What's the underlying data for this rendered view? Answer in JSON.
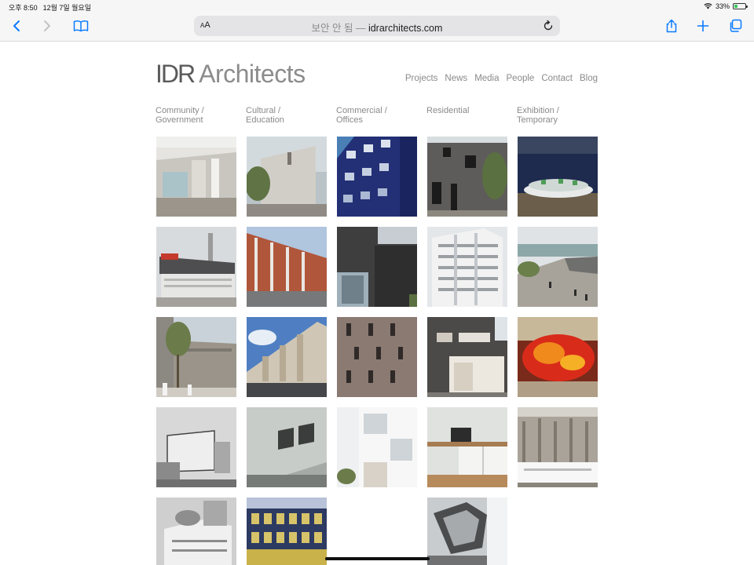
{
  "status_bar": {
    "time": "오후 8:50",
    "date": "12월 7일 월요일",
    "battery": "33%",
    "battery_level": 0.33
  },
  "toolbar": {
    "aa_label_big": "A",
    "aa_label_small": "A",
    "address_prefix": "보안 안 됨 —",
    "address_domain": "idrarchitects.com"
  },
  "site": {
    "logo_main": "IDR",
    "logo_sub": "Architects",
    "nav": [
      "Projects",
      "News",
      "Media",
      "People",
      "Contact",
      "Blog"
    ],
    "categories": [
      {
        "line1": "Community /",
        "line2": "Government"
      },
      {
        "line1": "Cultural /",
        "line2": "Education"
      },
      {
        "line1": "Commercial /",
        "line2": "Offices"
      },
      {
        "line1": "Residential",
        "line2": ""
      },
      {
        "line1": "Exhibition /",
        "line2": "Temporary"
      }
    ]
  },
  "colors": {
    "accent": "#0a7aff",
    "browser_bar": "#f6f6f6",
    "text_gray": "#8a8a8a"
  }
}
